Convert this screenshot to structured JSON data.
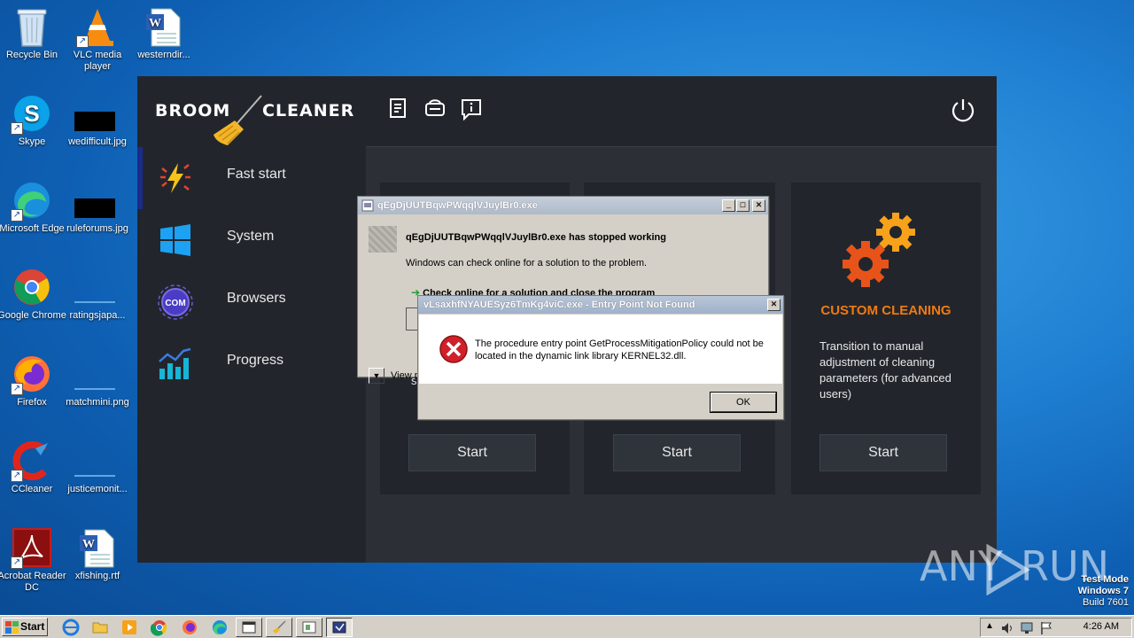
{
  "desktop": {
    "icons": [
      {
        "label": "Recycle Bin"
      },
      {
        "label": "VLC media player"
      },
      {
        "label": "westerndir..."
      },
      {
        "label": "Skype"
      },
      {
        "label": "wedifficult.jpg"
      },
      {
        "label": "Microsoft Edge"
      },
      {
        "label": "ruleforums.jpg"
      },
      {
        "label": "Google Chrome"
      },
      {
        "label": "ratingsjapa..."
      },
      {
        "label": "Firefox"
      },
      {
        "label": "matchmini.png"
      },
      {
        "label": "CCleaner"
      },
      {
        "label": "justicemonit..."
      },
      {
        "label": "Acrobat Reader DC"
      },
      {
        "label": "xfishing.rtf"
      }
    ]
  },
  "app": {
    "brand_left": "BROOM",
    "brand_right": "CLEANER",
    "sidebar": [
      {
        "label": "Fast start",
        "icon": "lightning-icon"
      },
      {
        "label": "System",
        "icon": "windows-icon"
      },
      {
        "label": "Browsers",
        "icon": "browser-com-icon"
      },
      {
        "label": "Progress",
        "icon": "chart-icon"
      }
    ],
    "cards": [
      {
        "button": "Start"
      },
      {
        "button": "Start"
      },
      {
        "title": "CUSTOM CLEANING",
        "description": "Transition to manual adjustment of cleaning parameters (for advanced users)",
        "button": "Start"
      }
    ],
    "card_partial_letter": "s"
  },
  "dialog_stopped": {
    "title": "qEgDjUUTBqwPWqqlVJuylBr0.exe",
    "heading": "qEgDjUUTBqwPWqqlVJuylBr0.exe has stopped working",
    "text": "Windows can check online for a solution to the problem.",
    "option": "Check online for a solution and close the program",
    "view_label": "View p"
  },
  "dialog_entry": {
    "title": "vLsaxhfNYAUESyz6TmKg4viC.exe - Entry Point Not Found",
    "message_line1": "The procedure entry point GetProcessMitigationPolicy could not be",
    "message_line2": "located in the dynamic link library KERNEL32.dll.",
    "ok_label": "OK"
  },
  "watermark": {
    "left": "ANY",
    "right": "RUN"
  },
  "testmode": {
    "line1": "Test Mode",
    "line2": "Windows 7",
    "line3": "Build 7601"
  },
  "taskbar": {
    "start_label": "Start",
    "clock": "4:26 AM"
  },
  "colors": {
    "accent_orange": "#f07a12",
    "app_dark": "#22262c",
    "error_red": "#d0202a"
  }
}
